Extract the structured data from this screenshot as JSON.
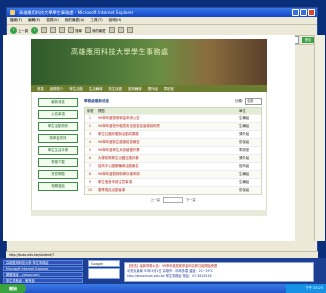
{
  "window": {
    "title": "高雄應用科技大學學生事務處 - Microsoft Internet Explorer"
  },
  "menu": {
    "items": [
      "檔案(F)",
      "編輯(E)",
      "檢視(V)",
      "我的最愛(A)",
      "工具(T)",
      "說明(H)"
    ]
  },
  "toolbar": {
    "back_label": "上一頁",
    "search_label": "搜尋",
    "favorites_label": "我的最愛"
  },
  "address": {
    "label": "網址(D)",
    "value": "http://kuas.edu.tw/student/?",
    "go_label": "移至"
  },
  "site": {
    "banner_title": "高雄應用科技大學學生事務處",
    "nav": [
      "首頁",
      "處務簡介",
      "學生活動",
      "生活輔導",
      "衛生保健",
      "諮商輔導",
      "課外組",
      "軍訓室"
    ]
  },
  "sidebar": {
    "buttons": [
      "最新消息",
      "公告事項",
      "學生活動資訊",
      "獎學金資訊",
      "學生生活手冊",
      "表格下載",
      "常見問題",
      "相關連結"
    ]
  },
  "main": {
    "heading": "學務處最新消息",
    "select_label": "分類:",
    "select_value": "全部",
    "columns": [
      "序號",
      "標題",
      "單位"
    ],
    "rows": [
      {
        "no": "1",
        "title": "96學年度獎助學金申請公告",
        "dept": "生輔組"
      },
      {
        "no": "2",
        "title": "96學年度校外租賃安全檢查及宣導說明會",
        "dept": "生輔組"
      },
      {
        "no": "3",
        "title": "學生社團評鑑與活動成果展",
        "dept": "課外組"
      },
      {
        "no": "4",
        "title": "96學年度新生健康檢查報告",
        "dept": "衛保組"
      },
      {
        "no": "5",
        "title": "96學年度學生兵役緩徵作業",
        "dept": "軍訓室"
      },
      {
        "no": "6",
        "title": "大專校院學生出國交換計畫",
        "dept": "課外組"
      },
      {
        "no": "7",
        "title": "諮商中心團體輔導活動報名",
        "dept": "諮商組"
      },
      {
        "no": "8",
        "title": "96學年度弱勢助學計畫申請",
        "dept": "生輔組"
      },
      {
        "no": "9",
        "title": "學生宿舍申請注意事項",
        "dept": "生輔組"
      },
      {
        "no": "10",
        "title": "春季捐血活動宣導",
        "dept": "衛保組"
      }
    ],
    "pager": {
      "prev": "上一頁",
      "next": "下一頁"
    }
  },
  "status": {
    "text": "http://kuas.edu.tw/student/?"
  },
  "taskbar_left": {
    "items": [
      "高雄應用科技大學 學生事務處",
      "Microsoft Internet Explorer",
      "網路搜尋 - yahoo.com",
      "學生事務處 - 教育部",
      "http://192.168.1.1",
      "DrWiki - 網路百科",
      "收件匣 - Outlook"
    ]
  },
  "google": {
    "label": "Google"
  },
  "ticker": {
    "line1": "【快訊】最新學務公告：96學年度獎助學金申請即日起開始受理",
    "line2": "中央氣象局 93年3月1日 高雄市：晴時多雲  溫度：22~29℃",
    "line3": "http://www.kuas.edu.tw  學生事務處  電話：07-3814526"
  },
  "taskbar": {
    "start_label": "開始",
    "clock": "下午 03:25"
  }
}
